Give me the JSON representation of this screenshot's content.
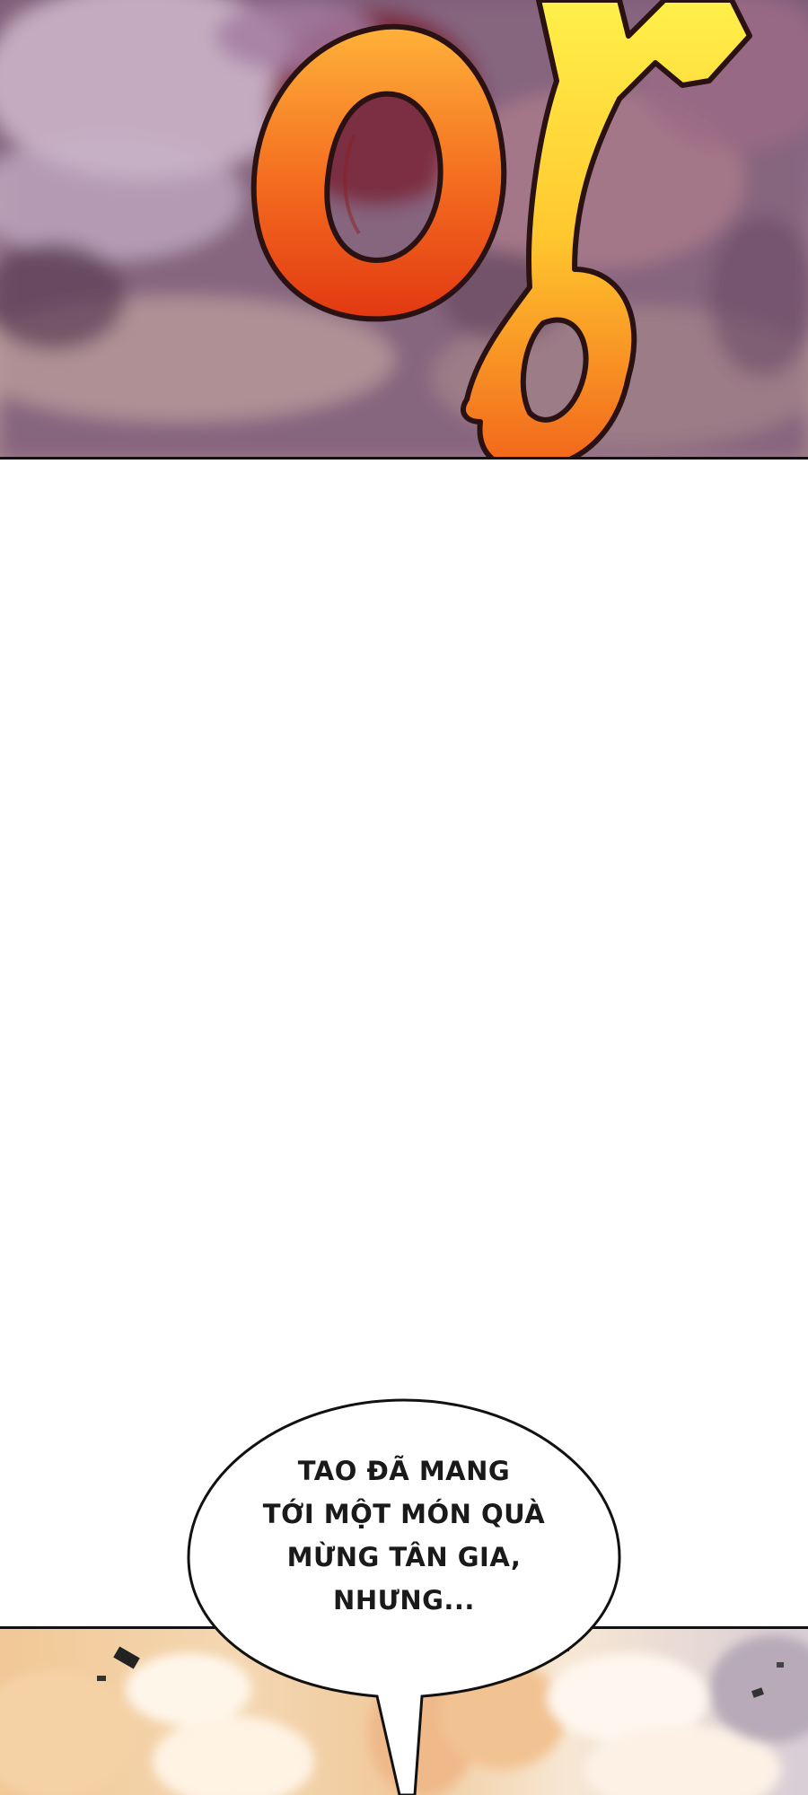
{
  "panels": {
    "top": {
      "sfx_text": "",
      "colors": {
        "background": "#8a6a86",
        "sfx_orange": "#f06a1c",
        "sfx_yellow": "#ffe13a",
        "outline": "#2a1212"
      }
    },
    "bottom": {
      "colors": {
        "background": "#f1c896",
        "smoke": "#fff6ea"
      }
    }
  },
  "speech_bubble": {
    "lines": [
      "TAO ĐÃ MANG",
      "TỚI MỘT MÓN QUÀ",
      "MỪNG TÂN GIA,",
      "NHƯNG..."
    ]
  }
}
